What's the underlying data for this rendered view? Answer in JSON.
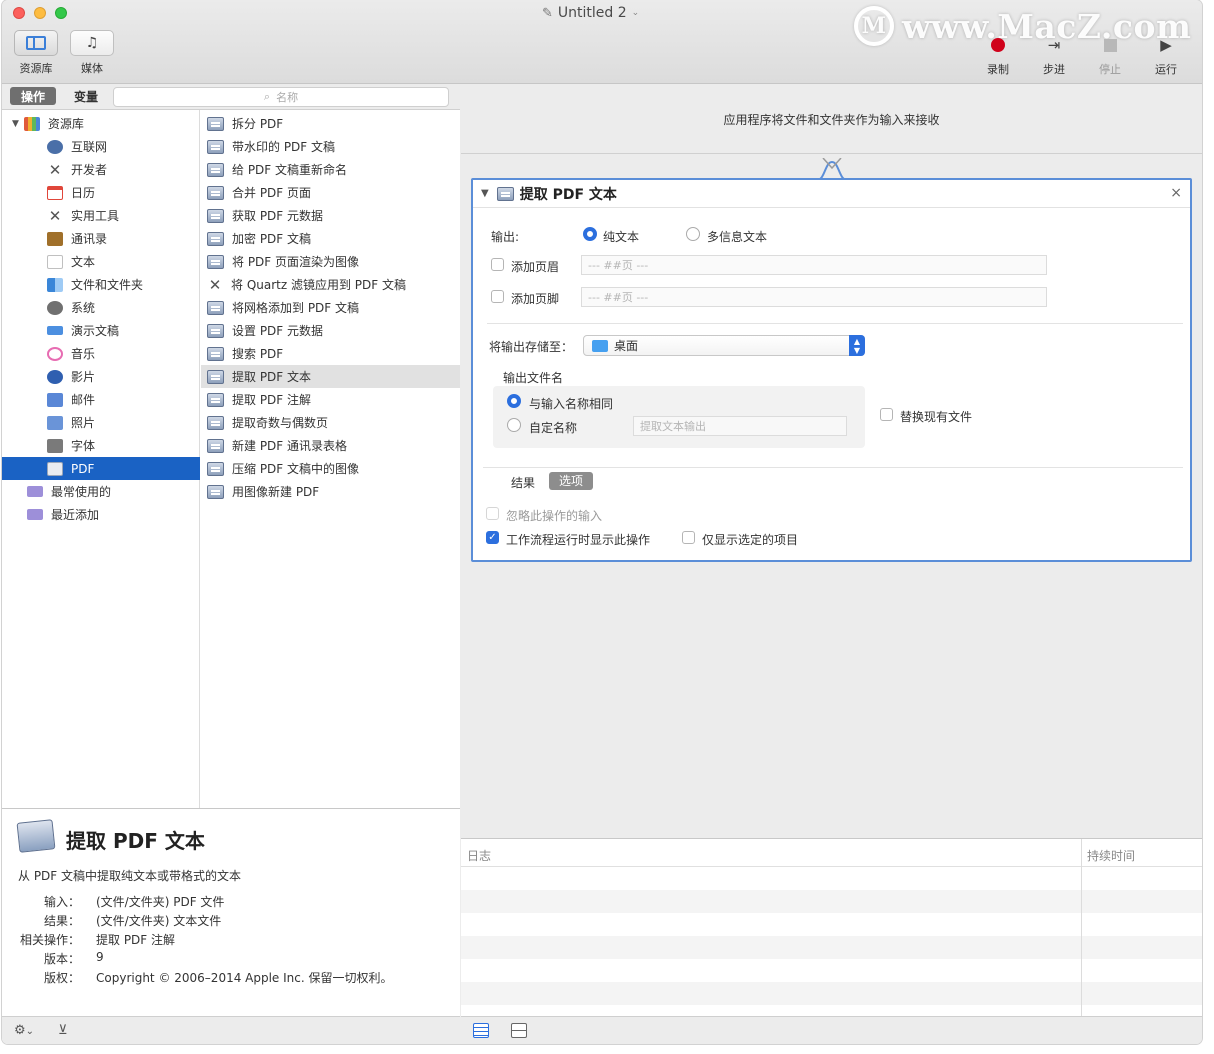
{
  "window": {
    "title": "Untitled 2"
  },
  "watermark": {
    "logo": "M",
    "text": "www.MacZ.com"
  },
  "toolbar": {
    "left": [
      {
        "label": "资源库",
        "icon": "library-icon"
      },
      {
        "label": "媒体",
        "icon": "media-icon"
      }
    ],
    "right": [
      {
        "label": "录制",
        "icon": "record-icon"
      },
      {
        "label": "步进",
        "icon": "step-icon"
      },
      {
        "label": "停止",
        "icon": "stop-icon"
      },
      {
        "label": "运行",
        "icon": "run-icon"
      }
    ]
  },
  "library": {
    "tabs": {
      "actions": "操作",
      "variables": "变量"
    },
    "search_placeholder": "名称",
    "categories": [
      {
        "label": "资源库",
        "icon": "library-icon",
        "color": "#7b4fc9"
      },
      {
        "label": "互联网",
        "icon": "globe-icon",
        "color": "#4a6fa8"
      },
      {
        "label": "开发者",
        "icon": "tools-icon",
        "color": "#555555"
      },
      {
        "label": "日历",
        "icon": "calendar-icon",
        "color": "#e0463a"
      },
      {
        "label": "实用工具",
        "icon": "tools-icon",
        "color": "#555555"
      },
      {
        "label": "通讯录",
        "icon": "contacts-icon",
        "color": "#a0702a"
      },
      {
        "label": "文本",
        "icon": "text-icon",
        "color": "#c0c0c0"
      },
      {
        "label": "文件和文件夹",
        "icon": "finder-icon",
        "color": "#3a86d8"
      },
      {
        "label": "系统",
        "icon": "system-icon",
        "color": "#707070"
      },
      {
        "label": "演示文稿",
        "icon": "presentation-icon",
        "color": "#4c8fe0"
      },
      {
        "label": "音乐",
        "icon": "music-icon",
        "color": "#e76cb2"
      },
      {
        "label": "影片",
        "icon": "movie-icon",
        "color": "#2f5fb0"
      },
      {
        "label": "邮件",
        "icon": "mail-icon",
        "color": "#5a87d6"
      },
      {
        "label": "照片",
        "icon": "photos-icon",
        "color": "#6a94d8"
      },
      {
        "label": "字体",
        "icon": "font-icon",
        "color": "#7a7a7a"
      },
      {
        "label": "PDF",
        "icon": "pdf-icon",
        "color": "#e9ecf1"
      },
      {
        "label": "最常使用的",
        "icon": "folder-smart-icon",
        "color": "#9d8fd9"
      },
      {
        "label": "最近添加",
        "icon": "folder-smart-icon",
        "color": "#9d8fd9"
      }
    ],
    "selected_category": "PDF",
    "actions": [
      {
        "label": "拆分 PDF",
        "icon": "pdf-icon"
      },
      {
        "label": "带水印的 PDF 文稿",
        "icon": "pdf-icon"
      },
      {
        "label": "给 PDF 文稿重新命名",
        "icon": "pdf-icon"
      },
      {
        "label": "合并 PDF 页面",
        "icon": "pdf-icon"
      },
      {
        "label": "获取 PDF 元数据",
        "icon": "pdf-icon"
      },
      {
        "label": "加密 PDF 文稿",
        "icon": "pdf-icon"
      },
      {
        "label": "将 PDF 页面渲染为图像",
        "icon": "pdf-icon"
      },
      {
        "label": "将 Quartz 滤镜应用到 PDF 文稿",
        "icon": "tools-icon"
      },
      {
        "label": "将网格添加到 PDF 文稿",
        "icon": "pdf-icon"
      },
      {
        "label": "设置 PDF 元数据",
        "icon": "pdf-icon"
      },
      {
        "label": "搜索 PDF",
        "icon": "pdf-icon"
      },
      {
        "label": "提取 PDF 文本",
        "icon": "pdf-icon"
      },
      {
        "label": "提取 PDF 注解",
        "icon": "pdf-icon"
      },
      {
        "label": "提取奇数与偶数页",
        "icon": "pdf-icon"
      },
      {
        "label": "新建 PDF 通讯录表格",
        "icon": "pdf-icon"
      },
      {
        "label": "压缩 PDF 文稿中的图像",
        "icon": "pdf-icon"
      },
      {
        "label": "用图像新建 PDF",
        "icon": "pdf-icon"
      }
    ],
    "selected_action": "提取 PDF 文本"
  },
  "description": {
    "title": "提取 PDF 文本",
    "summary": "从 PDF 文稿中提取纯文本或带格式的文本",
    "input_label": "输入：",
    "input_value": "(文件/文件夹) PDF 文件",
    "result_label": "结果：",
    "result_value": "(文件/文件夹) 文本文件",
    "related_label": "相关操作：",
    "related_value": "提取 PDF 注解",
    "version_label": "版本：",
    "version_value": "9",
    "copyright_label": "版权：",
    "copyright_value": "Copyright © 2006–2014 Apple Inc. 保留一切权利。"
  },
  "bottom_left": {
    "gear": "⚙",
    "chevron": "⌄",
    "toggle": "⊻"
  },
  "workflow": {
    "header": "应用程序将文件和文件夹作为输入来接收",
    "action": {
      "title": "提取 PDF 文本",
      "close": "×",
      "output_label": "输出:",
      "plain_text": "纯文本",
      "rich_text": "多信息文本",
      "add_header": "添加页眉",
      "header_placeholder": "--- ##页 ---",
      "add_footer": "添加页脚",
      "footer_placeholder": "--- ##页 ---",
      "save_to_label": "将输出存储至：",
      "save_to_value": "桌面",
      "filename_label": "输出文件名",
      "same_as_input": "与输入名称相同",
      "custom_name": "自定名称",
      "custom_placeholder": "提取文本输出",
      "replace_existing": "替换现有文件",
      "results_label": "结果",
      "options_label": "选项",
      "ignore_input": "忽略此操作的输入",
      "show_when_run": "工作流程运行时显示此操作",
      "show_selected_only": "仅显示选定的项目"
    }
  },
  "log": {
    "col_log": "日志",
    "col_duration": "持续时间"
  }
}
